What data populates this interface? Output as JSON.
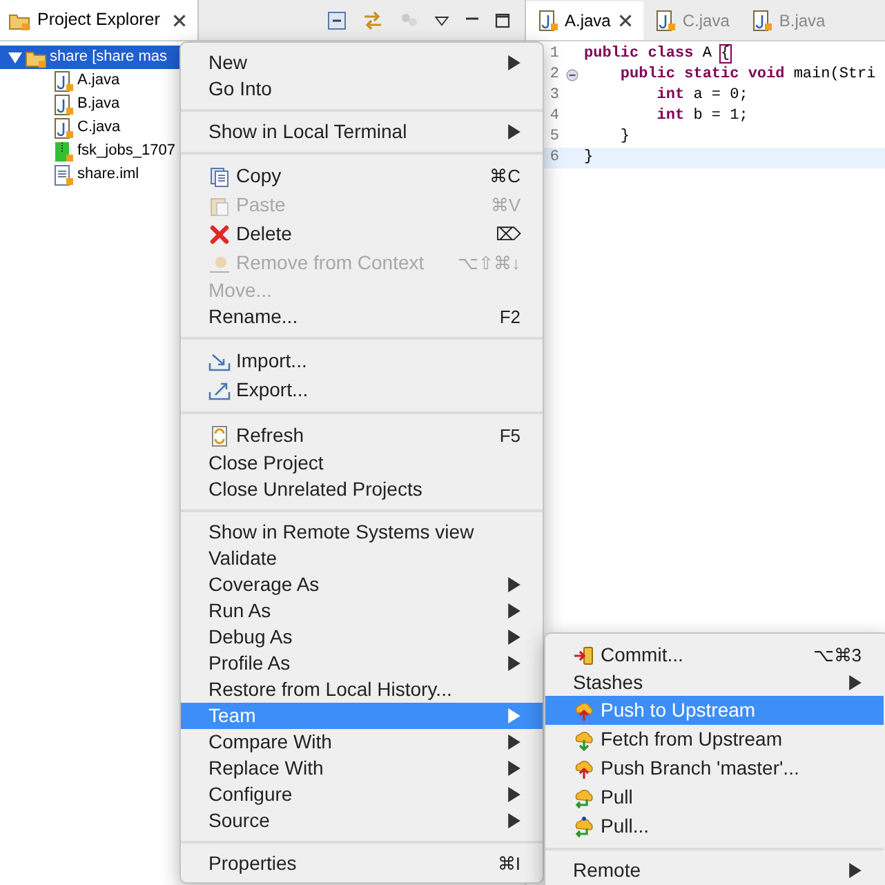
{
  "explorer": {
    "title": "Project Explorer",
    "tree": [
      {
        "label": "share [share mas",
        "kind": "project",
        "selected": true,
        "expanded": true,
        "children": [
          {
            "label": "A.java",
            "kind": "java",
            "selected": false
          },
          {
            "label": "B.java",
            "kind": "java",
            "selected": false
          },
          {
            "label": "C.java",
            "kind": "java",
            "selected": false
          },
          {
            "label": "fsk_jobs_1707",
            "kind": "archive",
            "selected": false
          },
          {
            "label": "share.iml",
            "kind": "file",
            "selected": false
          }
        ]
      }
    ]
  },
  "editor": {
    "tabs": [
      {
        "label": "A.java",
        "selected": true
      },
      {
        "label": "C.java",
        "selected": false
      },
      {
        "label": "B.java",
        "selected": false
      }
    ],
    "lines": [
      {
        "number": "1",
        "current": false,
        "fold": false,
        "tokens": [
          {
            "text": "public class ",
            "kind": "keyword"
          },
          {
            "text": "A ",
            "kind": "plain"
          },
          {
            "text": "{",
            "kind": "bracket"
          }
        ]
      },
      {
        "number": "2",
        "current": false,
        "fold": true,
        "tokens": [
          {
            "text": "    public static void ",
            "kind": "keyword"
          },
          {
            "text": "main(Stri",
            "kind": "plain"
          }
        ]
      },
      {
        "number": "3",
        "current": false,
        "fold": false,
        "tokens": [
          {
            "text": "        int ",
            "kind": "keyword"
          },
          {
            "text": "a = 0;",
            "kind": "plain"
          }
        ]
      },
      {
        "number": "4",
        "current": false,
        "fold": false,
        "tokens": [
          {
            "text": "        int ",
            "kind": "keyword"
          },
          {
            "text": "b = 1;",
            "kind": "plain"
          }
        ]
      },
      {
        "number": "5",
        "current": false,
        "fold": false,
        "tokens": [
          {
            "text": "    }",
            "kind": "plain"
          }
        ]
      },
      {
        "number": "6",
        "current": true,
        "fold": false,
        "tokens": [
          {
            "text": "}",
            "kind": "plain"
          }
        ]
      }
    ]
  },
  "context_menu": {
    "sections": [
      [
        {
          "label": "New",
          "kind": "plain",
          "submenu": true,
          "disabled": false,
          "selected": false
        },
        {
          "label": "Go Into",
          "kind": "plain",
          "submenu": false,
          "disabled": false,
          "selected": false
        }
      ],
      [
        {
          "label": "Show in Local Terminal",
          "kind": "plain",
          "submenu": true,
          "disabled": false,
          "selected": false
        }
      ],
      [
        {
          "label": "Copy",
          "kind": "copy",
          "shortcut": "⌘C",
          "submenu": false,
          "disabled": false,
          "selected": false
        },
        {
          "label": "Paste",
          "kind": "paste",
          "shortcut": "⌘V",
          "submenu": false,
          "disabled": true,
          "selected": false
        },
        {
          "label": "Delete",
          "kind": "delete",
          "shortcut": "⌦",
          "submenu": false,
          "disabled": false,
          "selected": false
        },
        {
          "label": "Remove from Context",
          "kind": "remove",
          "shortcut": "⌥⇧⌘↓",
          "submenu": false,
          "disabled": true,
          "selected": false
        },
        {
          "label": "Move...",
          "kind": "plain",
          "submenu": false,
          "disabled": true,
          "selected": false
        },
        {
          "label": "Rename...",
          "kind": "plain",
          "shortcut": "F2",
          "submenu": false,
          "disabled": false,
          "selected": false
        }
      ],
      [
        {
          "label": "Import...",
          "kind": "import",
          "submenu": false,
          "disabled": false,
          "selected": false
        },
        {
          "label": "Export...",
          "kind": "export",
          "submenu": false,
          "disabled": false,
          "selected": false
        }
      ],
      [
        {
          "label": "Refresh",
          "kind": "refresh",
          "shortcut": "F5",
          "submenu": false,
          "disabled": false,
          "selected": false
        },
        {
          "label": "Close Project",
          "kind": "plain",
          "submenu": false,
          "disabled": false,
          "selected": false
        },
        {
          "label": "Close Unrelated Projects",
          "kind": "plain",
          "submenu": false,
          "disabled": false,
          "selected": false
        }
      ],
      [
        {
          "label": "Show in Remote Systems view",
          "kind": "plain",
          "submenu": false,
          "disabled": false,
          "selected": false
        },
        {
          "label": "Validate",
          "kind": "plain",
          "submenu": false,
          "disabled": false,
          "selected": false
        },
        {
          "label": "Coverage As",
          "kind": "plain",
          "submenu": true,
          "disabled": false,
          "selected": false
        },
        {
          "label": "Run As",
          "kind": "plain",
          "submenu": true,
          "disabled": false,
          "selected": false
        },
        {
          "label": "Debug As",
          "kind": "plain",
          "submenu": true,
          "disabled": false,
          "selected": false
        },
        {
          "label": "Profile As",
          "kind": "plain",
          "submenu": true,
          "disabled": false,
          "selected": false
        },
        {
          "label": "Restore from Local History...",
          "kind": "plain",
          "submenu": false,
          "disabled": false,
          "selected": false
        },
        {
          "label": "Team",
          "kind": "plain",
          "submenu": true,
          "disabled": false,
          "selected": true
        },
        {
          "label": "Compare With",
          "kind": "plain",
          "submenu": true,
          "disabled": false,
          "selected": false
        },
        {
          "label": "Replace With",
          "kind": "plain",
          "submenu": true,
          "disabled": false,
          "selected": false
        },
        {
          "label": "Configure",
          "kind": "plain",
          "submenu": true,
          "disabled": false,
          "selected": false
        },
        {
          "label": "Source",
          "kind": "plain",
          "submenu": true,
          "disabled": false,
          "selected": false
        }
      ],
      [
        {
          "label": "Properties",
          "kind": "plain",
          "shortcut": "⌘I",
          "submenu": false,
          "disabled": false,
          "selected": false
        }
      ]
    ]
  },
  "team_submenu": {
    "sections": [
      [
        {
          "label": "Commit...",
          "kind": "commit",
          "shortcut": "⌥⌘3",
          "submenu": false,
          "disabled": false,
          "selected": false
        },
        {
          "label": "Stashes",
          "kind": "plain",
          "submenu": true,
          "disabled": false,
          "selected": false
        },
        {
          "label": "Push to Upstream",
          "kind": "push",
          "submenu": false,
          "disabled": false,
          "selected": true
        },
        {
          "label": "Fetch from Upstream",
          "kind": "fetch",
          "submenu": false,
          "disabled": false,
          "selected": false
        },
        {
          "label": "Push Branch 'master'...",
          "kind": "push",
          "submenu": false,
          "disabled": false,
          "selected": false
        },
        {
          "label": "Pull",
          "kind": "pull",
          "submenu": false,
          "disabled": false,
          "selected": false
        },
        {
          "label": "Pull...",
          "kind": "pull-dialog",
          "submenu": false,
          "disabled": false,
          "selected": false
        }
      ],
      [
        {
          "label": "Remote",
          "kind": "plain",
          "submenu": true,
          "disabled": false,
          "selected": false
        }
      ]
    ]
  }
}
